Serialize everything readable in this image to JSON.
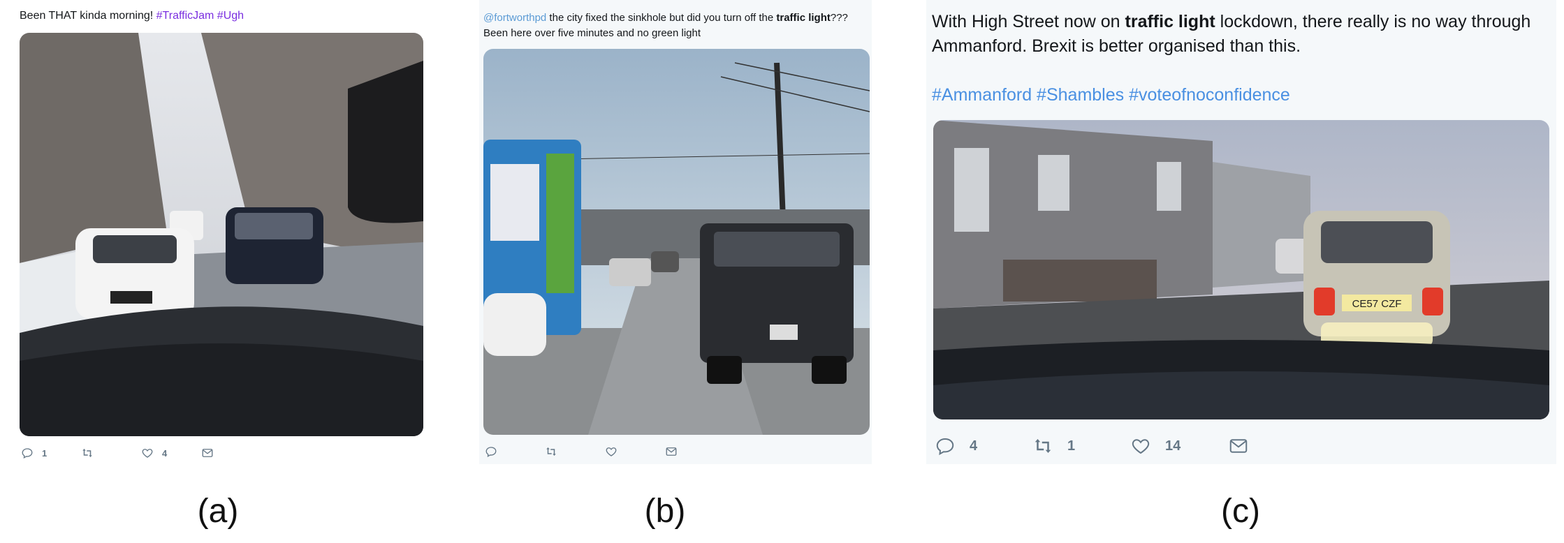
{
  "tweets": {
    "a": {
      "text_lead": "Been THAT kinda morning! ",
      "hashtags": "#TrafficJam #Ugh",
      "actions": {
        "reply_count": "1",
        "retweet_count": "",
        "like_count": "4"
      }
    },
    "b": {
      "mention": "@fortworthpd",
      "text_mid": " the city fixed the sinkhole but did you turn off the ",
      "bold": "traffic light",
      "text_end": "??? Been here over five minutes and no green light",
      "actions": {
        "reply_count": "",
        "retweet_count": "",
        "like_count": ""
      }
    },
    "c": {
      "text_lead": "With High Street now on ",
      "bold": "traffic light",
      "text_end": " lockdown, there really is no way through Ammanford. Brexit is better organised than this.",
      "hashtags": "#Ammanford #Shambles #voteofnoconfidence",
      "plate": "CE57 CZF",
      "actions": {
        "reply_count": "4",
        "retweet_count": "1",
        "like_count": "14"
      }
    }
  },
  "captions": {
    "a": "(a)",
    "b": "(b)",
    "c": "(c)"
  },
  "icons": [
    "reply-icon",
    "retweet-icon",
    "like-icon",
    "dm-icon"
  ],
  "colors": {
    "hashtag_purple": "#7a2ee0",
    "mention_blue": "#5b9bd5",
    "hashtag_blue": "#4a90e2",
    "action_gray": "#657786"
  }
}
